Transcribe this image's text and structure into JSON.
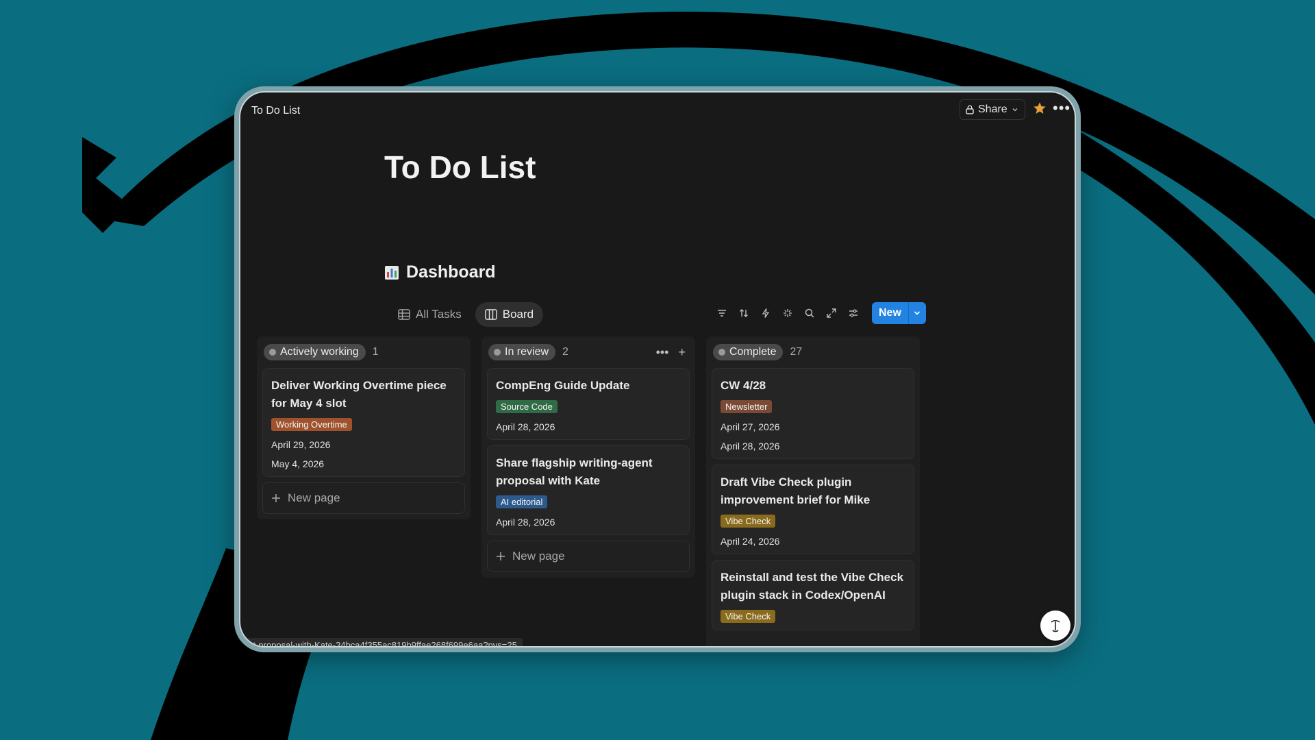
{
  "window": {
    "tab_title": "To Do List"
  },
  "topbar": {
    "share_label": "Share"
  },
  "page": {
    "title": "To Do List"
  },
  "dashboard": {
    "heading": "Dashboard",
    "views": [
      {
        "label": "All Tasks",
        "active": false
      },
      {
        "label": "Board",
        "active": true
      }
    ],
    "new_label": "New"
  },
  "columns": [
    {
      "status": "Actively working",
      "count": "1",
      "cards": [
        {
          "title": "Deliver Working Overtime piece for May 4 slot",
          "tag": "Working Overtime",
          "tag_color": "#a0522d",
          "dates": [
            "April 29, 2026",
            "May 4, 2026"
          ]
        }
      ],
      "new_page_label": "New page"
    },
    {
      "status": "In review",
      "count": "2",
      "cards": [
        {
          "title": "CompEng Guide Update",
          "tag": "Source Code",
          "tag_color": "#2f6b45",
          "dates": [
            "April 28, 2026"
          ]
        },
        {
          "title": "Share flagship writing-agent proposal with Kate",
          "tag": "AI editorial",
          "tag_color": "#2d5a8c",
          "dates": [
            "April 28, 2026"
          ]
        }
      ],
      "new_page_label": "New page"
    },
    {
      "status": "Complete",
      "count": "27",
      "cards": [
        {
          "title": "CW 4/28",
          "tag": "Newsletter",
          "tag_color": "#7a4a35",
          "dates": [
            "April 27, 2026",
            "April 28, 2026"
          ]
        },
        {
          "title": "Draft Vibe Check plugin improvement brief for Mike",
          "tag": "Vibe Check",
          "tag_color": "#8a6a1c",
          "dates": [
            "April 24, 2026"
          ]
        },
        {
          "title": "Reinstall and test the Vibe Check plugin stack in Codex/OpenAI",
          "tag": "Vibe Check",
          "tag_color": "#8a6a1c",
          "dates": []
        }
      ]
    }
  ],
  "status_bar": {
    "url": "ent-proposal-with-Kate-34bca4f355ac819b9ffae268f699e6aa?pvs=25"
  },
  "colors": {
    "accent": "#2383e2",
    "star": "#e8a13a",
    "background": "#0a6e80"
  }
}
